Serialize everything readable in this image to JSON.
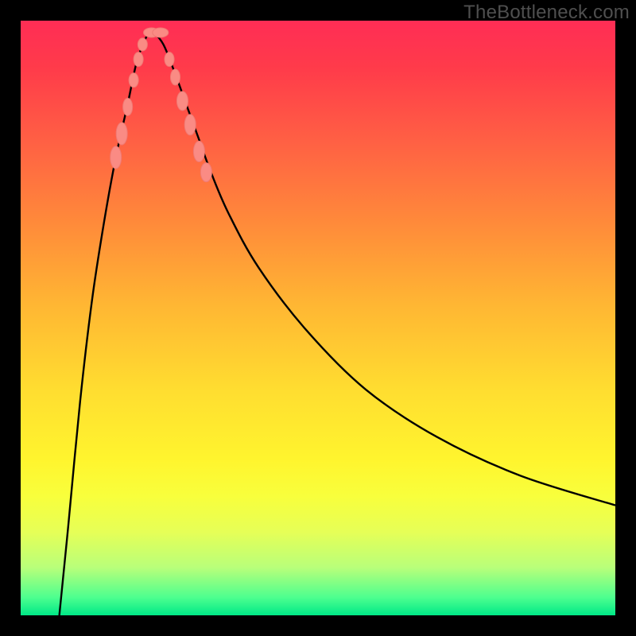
{
  "watermark": "TheBottleneck.com",
  "colors": {
    "frame": "#000000",
    "curve": "#000000",
    "marker_fill": "#fa8b84",
    "marker_stroke": "#f07a74"
  },
  "chart_data": {
    "type": "line",
    "title": "",
    "xlabel": "",
    "ylabel": "",
    "xlim": [
      0,
      100
    ],
    "ylim": [
      0,
      100
    ],
    "grid": false,
    "legend": false,
    "note": "V-shaped bottleneck curve on a thermal gradient; apex near x≈22, y≈98. Left branch descends steeply from top-left; right branch rises with decreasing slope toward the right.",
    "series": [
      {
        "name": "left_branch",
        "x": [
          6.5,
          8,
          10,
          12,
          14,
          16,
          18,
          19.5,
          21,
          22
        ],
        "y": [
          0,
          15,
          36,
          53,
          66,
          77,
          86,
          93,
          97,
          98.5
        ]
      },
      {
        "name": "right_branch",
        "x": [
          22,
          24,
          26,
          28,
          30,
          32,
          35,
          40,
          48,
          58,
          70,
          84,
          100
        ],
        "y": [
          98.5,
          96,
          91,
          85.5,
          80,
          74.5,
          67.5,
          58.5,
          48,
          38,
          30,
          23.5,
          18.5
        ]
      }
    ],
    "markers": [
      {
        "x": 16.0,
        "y": 77.0,
        "rx": 7,
        "ry": 14
      },
      {
        "x": 17.0,
        "y": 81.0,
        "rx": 7,
        "ry": 14
      },
      {
        "x": 18.0,
        "y": 85.5,
        "rx": 6,
        "ry": 11
      },
      {
        "x": 19.0,
        "y": 90.0,
        "rx": 6,
        "ry": 9
      },
      {
        "x": 19.8,
        "y": 93.5,
        "rx": 6,
        "ry": 9
      },
      {
        "x": 20.5,
        "y": 96.0,
        "rx": 6,
        "ry": 8
      },
      {
        "x": 22.0,
        "y": 98.0,
        "rx": 10,
        "ry": 6
      },
      {
        "x": 23.5,
        "y": 98.0,
        "rx": 10,
        "ry": 6
      },
      {
        "x": 25.0,
        "y": 93.5,
        "rx": 6,
        "ry": 9
      },
      {
        "x": 26.0,
        "y": 90.5,
        "rx": 6,
        "ry": 10
      },
      {
        "x": 27.2,
        "y": 86.5,
        "rx": 7,
        "ry": 12
      },
      {
        "x": 28.5,
        "y": 82.5,
        "rx": 7,
        "ry": 13
      },
      {
        "x": 30.0,
        "y": 78.0,
        "rx": 7,
        "ry": 13
      },
      {
        "x": 31.2,
        "y": 74.5,
        "rx": 7,
        "ry": 12
      }
    ]
  }
}
